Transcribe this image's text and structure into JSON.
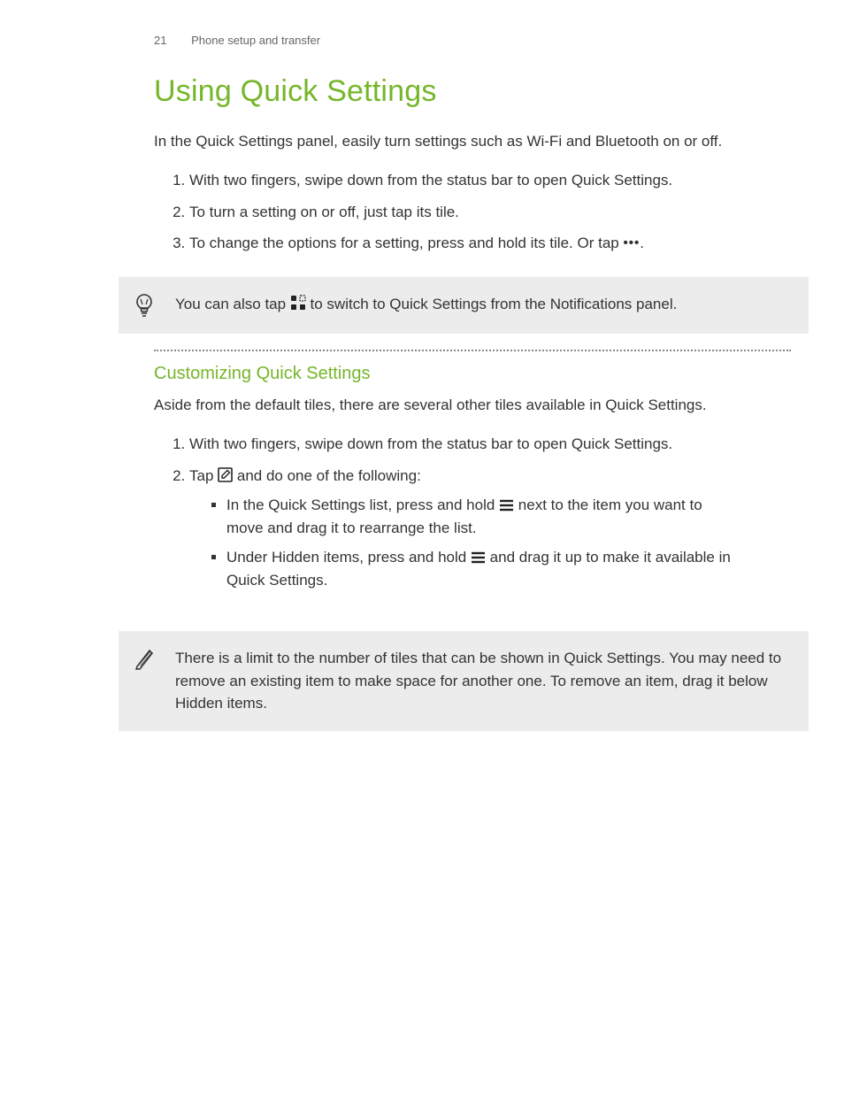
{
  "header": {
    "page_number": "21",
    "section": "Phone setup and transfer"
  },
  "title": "Using Quick Settings",
  "intro": "In the Quick Settings panel, easily turn settings such as Wi-Fi and Bluetooth on or off.",
  "steps1": {
    "s1": "With two fingers, swipe down from the status bar to open Quick Settings.",
    "s2": "To turn a setting on or off, just tap its tile.",
    "s3_pre": "To change the options for a setting, press and hold its tile. Or tap ",
    "s3_post": "."
  },
  "tip": {
    "pre": "You can also tap ",
    "post": " to switch to Quick Settings from the Notifications panel."
  },
  "sub": {
    "heading": "Customizing Quick Settings",
    "intro": "Aside from the default tiles, there are several other tiles available in Quick Settings."
  },
  "steps2": {
    "s1": "With two fingers, swipe down from the status bar to open Quick Settings.",
    "s2_pre": "Tap ",
    "s2_post": " and do one of the following:",
    "b1_pre": "In the Quick Settings list, press and hold ",
    "b1_post": " next to the item you want to move and drag it to rearrange the list.",
    "b2_pre": "Under Hidden items, press and hold ",
    "b2_post": " and drag it up to make it available in Quick Settings."
  },
  "note": "There is a limit to the number of tiles that can be shown in Quick Settings. You may need to remove an existing item to make space for another one. To remove an item, drag it below Hidden items.",
  "icons": {
    "more": "more-options-icon",
    "grid": "quick-settings-grid-icon",
    "edit": "edit-icon",
    "drag": "drag-handle-icon",
    "bulb": "lightbulb-tip-icon",
    "pencil_callout": "pencil-note-icon"
  }
}
